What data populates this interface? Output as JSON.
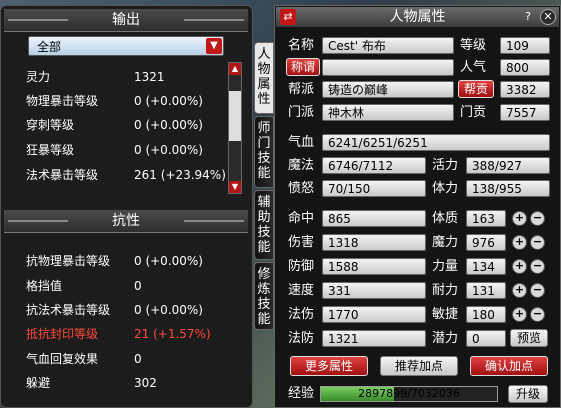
{
  "output_panel": {
    "title": "输出",
    "filter": "全部",
    "rows": [
      {
        "label": "灵力",
        "value": "1321",
        "red": false
      },
      {
        "label": "物理暴击等级",
        "value": "0 (+0.00%)",
        "red": false
      },
      {
        "label": "穿刺等级",
        "value": "0 (+0.00%)",
        "red": false
      },
      {
        "label": "狂暴等级",
        "value": "0 (+0.00%)",
        "red": false
      },
      {
        "label": "法术暴击等级",
        "value": "261 (+23.94%)",
        "red": false
      }
    ]
  },
  "resist_panel": {
    "title": "抗性",
    "rows": [
      {
        "label": "抗物理暴击等级",
        "value": "0 (+0.00%)",
        "red": false
      },
      {
        "label": "格挡值",
        "value": "0",
        "red": false
      },
      {
        "label": "抗法术暴击等级",
        "value": "0 (+0.00%)",
        "red": false
      },
      {
        "label": "抵抗封印等级",
        "value": "21 (+1.57%)",
        "red": true
      },
      {
        "label": "气血回复效果",
        "value": "0",
        "red": false
      },
      {
        "label": "躲避",
        "value": "302",
        "red": false
      }
    ]
  },
  "tabs": [
    "人物属性",
    "师门技能",
    "辅助技能",
    "修炼技能"
  ],
  "window": {
    "title": "人物属性",
    "help": "?",
    "close": "✕"
  },
  "char": {
    "name_label": "名称",
    "name": "Cest' 布布",
    "level_label": "等级",
    "level": "109",
    "title_btn": "称谓",
    "title_value": "",
    "popularity_label": "人气",
    "popularity": "800",
    "gang_label": "帮派",
    "gang": "铸造の巅峰",
    "gang_contrib_btn": "帮贡",
    "gang_contrib": "3382",
    "school_label": "门派",
    "school": "神木林",
    "school_contrib_label": "门贡",
    "school_contrib": "7557",
    "hp_label": "气血",
    "hp": "6241/6251/6251",
    "mp_label": "魔法",
    "mp": "6746/7112",
    "vitality_label": "活力",
    "vitality": "388/927",
    "rage_label": "愤怒",
    "rage": "70/150",
    "stamina_label": "体力",
    "stamina": "138/955"
  },
  "stats": [
    {
      "label": "命中",
      "value": "865",
      "attr_label": "体质",
      "attr_value": "163"
    },
    {
      "label": "伤害",
      "value": "1318",
      "attr_label": "魔力",
      "attr_value": "976"
    },
    {
      "label": "防御",
      "value": "1588",
      "attr_label": "力量",
      "attr_value": "134"
    },
    {
      "label": "速度",
      "value": "331",
      "attr_label": "耐力",
      "attr_value": "131"
    },
    {
      "label": "法伤",
      "value": "1770",
      "attr_label": "敏捷",
      "attr_value": "180"
    }
  ],
  "defense": {
    "label": "法防",
    "value": "1321",
    "potential_label": "潜力",
    "potential": "0",
    "preview_btn": "预览"
  },
  "buttons": {
    "more": "更多属性",
    "recommend": "推荐加点",
    "confirm": "确认加点",
    "upgrade": "升级"
  },
  "exp": {
    "label": "经验",
    "text": "2897899/7032036",
    "fraction": 0.412
  }
}
